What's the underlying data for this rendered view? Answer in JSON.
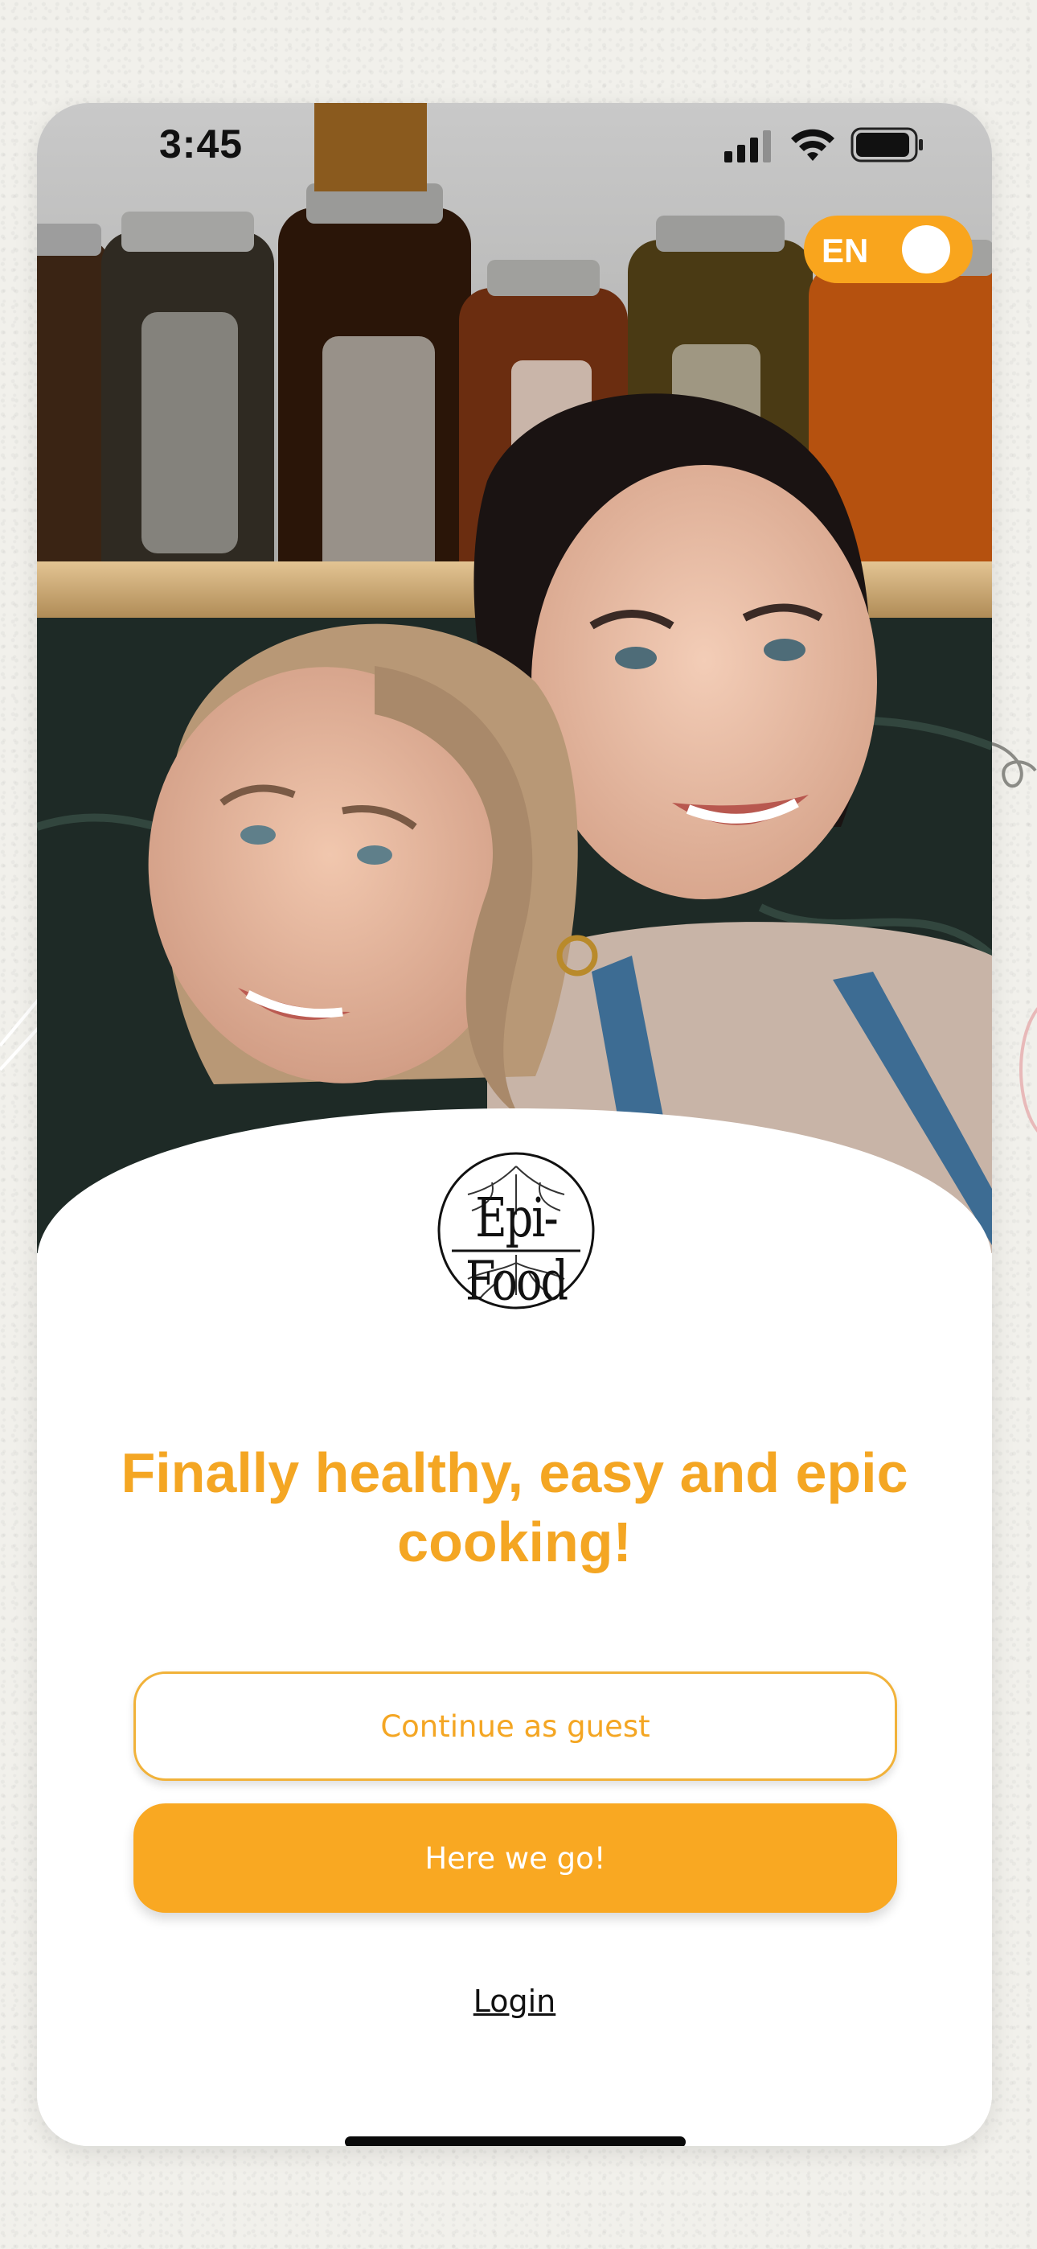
{
  "status_bar": {
    "time": "3:45"
  },
  "language_toggle": {
    "label": "EN"
  },
  "brand": {
    "logo_text": "Epi-Food"
  },
  "hero": {
    "headline": "Finally healthy, easy and epic cooking!"
  },
  "actions": {
    "guest_label": "Continue as guest",
    "primary_label": "Here we go!",
    "login_label": "Login"
  },
  "colors": {
    "accent": "#f9a822",
    "accent_text": "#f4a623",
    "background": "#f1f0eb"
  },
  "icons": [
    "signal-icon",
    "wifi-icon",
    "battery-icon",
    "epi-food-logo"
  ]
}
